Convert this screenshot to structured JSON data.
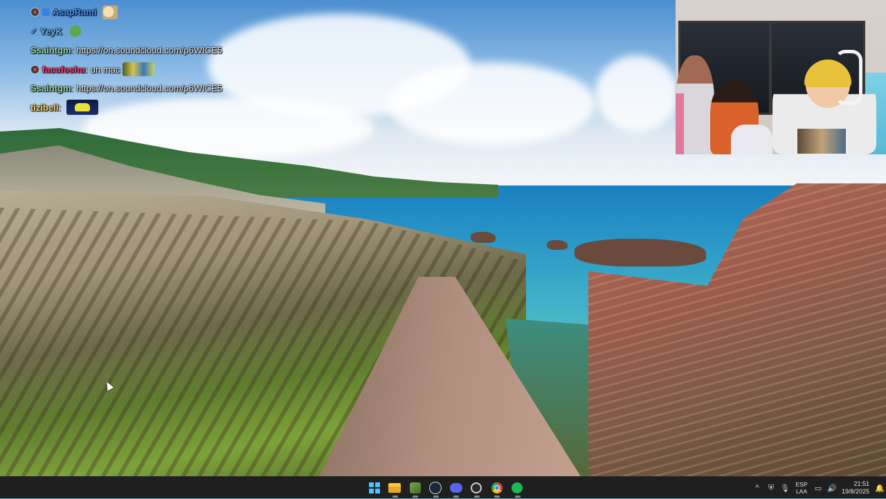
{
  "chat": {
    "messages": [
      {
        "user": "AsapRami",
        "color": "#4f8df0",
        "text": "",
        "badges": [
          "dark",
          "cube"
        ],
        "emote": "cat"
      },
      {
        "user": "YeyK",
        "color": "#66b7f2",
        "text": "",
        "badges": [
          "check"
        ],
        "emote": "frog"
      },
      {
        "user": "Ssaintgm",
        "color": "#9fd6ab",
        "text": "https://on.soundcloud.com/p6WICE5",
        "badges": [],
        "emote": ""
      },
      {
        "user": "facufoshu",
        "color": "#ff3b6f",
        "text": "un mac",
        "badges": [
          "dark"
        ],
        "emote": "wide"
      },
      {
        "user": "Ssaintgm",
        "color": "#9fd6ab",
        "text": "https://on.soundcloud.com/p6WICE5",
        "badges": [],
        "emote": ""
      },
      {
        "user": "tizibell",
        "color": "#f0d67a",
        "text": "",
        "badges": [],
        "emote": "car"
      }
    ]
  },
  "taskbar": {
    "apps": [
      {
        "name": "start",
        "icon": "windows-logo-icon"
      },
      {
        "name": "file-explorer",
        "icon": "folder-icon"
      },
      {
        "name": "green-app",
        "icon": "app-green-icon"
      },
      {
        "name": "steam",
        "icon": "steam-icon"
      },
      {
        "name": "discord",
        "icon": "discord-icon"
      },
      {
        "name": "obs",
        "icon": "obs-icon"
      },
      {
        "name": "chrome",
        "icon": "chrome-icon"
      },
      {
        "name": "spotify",
        "icon": "spotify-icon"
      }
    ],
    "tray": {
      "chevron": "^",
      "lang_line1": "ESP",
      "lang_line2": "LAA",
      "time": "21:51",
      "date": "19/8/2025"
    }
  },
  "colors": {
    "taskbar_bg": "#1f1f1f",
    "accent": "#4cc2ff"
  }
}
